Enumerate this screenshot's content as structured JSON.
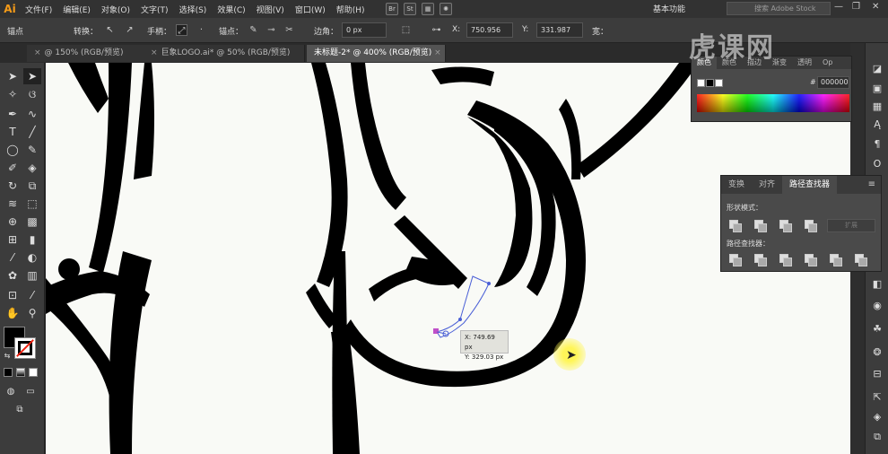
{
  "app": {
    "logo": "Ai"
  },
  "menu": [
    "文件(F)",
    "编辑(E)",
    "对象(O)",
    "文字(T)",
    "选择(S)",
    "效果(C)",
    "视图(V)",
    "窗口(W)",
    "帮助(H)"
  ],
  "menu_icons": [
    "Br",
    "St"
  ],
  "workspace": "基本功能",
  "stock_search": {
    "placeholder": "搜索 Adobe Stock"
  },
  "window_controls": [
    "—",
    "❐",
    "✕"
  ],
  "controlbar": {
    "anchor_label": "锚点",
    "convert_label": "转换：",
    "handle_label": "手柄：",
    "anchor_points_label": "锚点：",
    "corner_label": "边角：",
    "corner_value": "0 px",
    "x_label": "X:",
    "x_value": "750.956",
    "y_label": "Y:",
    "y_value": "331.987",
    "w_label": "宽："
  },
  "tabs": [
    {
      "label": "@ 150% (RGB/预览)",
      "active": false
    },
    {
      "label": "巨象LOGO.ai* @ 50% (RGB/预览)",
      "active": false
    },
    {
      "label": "未标题-2* @ 400% (RGB/预览)",
      "active": true
    }
  ],
  "coord_tooltip": {
    "x": "X: 749.69 px",
    "y": "Y: 329.03 px"
  },
  "color_panel": {
    "tabs": [
      "颜色",
      "颜色",
      "描边",
      "渐变",
      "透明",
      "Op"
    ],
    "hex_prefix": "#",
    "hex_value": "000000"
  },
  "pathfinder": {
    "tabs": [
      "变换",
      "对齐",
      "路径查找器"
    ],
    "shape_modes_label": "形状模式：",
    "pathfinders_label": "路径查找器：",
    "expand_label": "扩展"
  },
  "watermark": "虎课网",
  "colors": {
    "accent": "#f59b18",
    "canvas": "#f9faf6",
    "artwork": "#000000",
    "path_selection": "#4a5fd6"
  }
}
